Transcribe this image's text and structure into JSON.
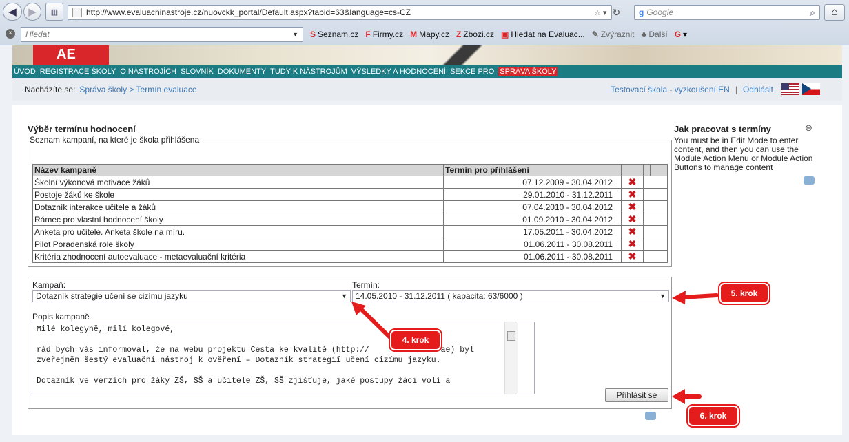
{
  "browser": {
    "url": "http://www.evaluacninastroje.cz/nuovckk_portal/Default.aspx?tabid=63&language=cs-CZ",
    "google_placeholder": "Google",
    "search_placeholder": "Hledat",
    "toolbar_items": [
      "Seznam.cz",
      "Firmy.cz",
      "Mapy.cz",
      "Zbozi.cz",
      "Hledat na Evaluac...",
      "Zvýraznit",
      "Další"
    ]
  },
  "banner": {
    "text": "AE"
  },
  "menu": [
    "ÚVOD",
    "REGISTRACE ŠKOLY",
    "O NÁSTROJÍCH",
    "SLOVNÍK",
    "DOKUMENTY",
    "TUDY K NÁSTROJŮM",
    "VÝSLEDKY A HODNOCENÍ",
    "SEKCE PRO",
    "SPRÁVA ŠKOLY"
  ],
  "breadcrumb": {
    "label": "Nacházíte se:",
    "path": "Správa školy > Termín evaluace",
    "school": "Testovací škola - vyzkoušení EN",
    "sep": "|",
    "logout": "Odhlásit"
  },
  "main": {
    "title": "Výběr termínu hodnocení",
    "legend": "Seznam kampaní, na které je škola přihlášena",
    "col_campaign": "Název kampaně",
    "col_term": "Termín pro přihlášení",
    "rows": [
      {
        "name": "Školní výkonová motivace žáků",
        "term": "07.12.2009 - 30.04.2012"
      },
      {
        "name": "Postoje žáků ke škole",
        "term": "29.01.2010 - 31.12.2011"
      },
      {
        "name": "Dotazník interakce učitele a žáků",
        "term": "07.04.2010 - 30.04.2012"
      },
      {
        "name": "Rámec pro vlastní hodnocení školy",
        "term": "01.09.2010 - 30.04.2012"
      },
      {
        "name": "Anketa pro učitele. Anketa škole na míru.",
        "term": "17.05.2011 - 30.04.2012"
      },
      {
        "name": "Pilot Poradenská role školy",
        "term": "01.06.2011 - 30.08.2011"
      },
      {
        "name": "Kritéria zhodnocení autoevaluace - metaevaluační kritéria",
        "term": "01.06.2011 - 30.08.2011"
      }
    ],
    "label_campaign": "Kampaň:",
    "label_term": "Termín:",
    "campaign_value": "Dotazník strategie učení se cizímu jazyku",
    "term_value": "14.05.2010 - 31.12.2011 ( kapacita: 63/6000 )",
    "desc_label": "Popis kampaně",
    "desc_text": "Milé kolegyně, milí kolegové,\n\nrád bych vás informoval, že na webu projektu Cesta ke kvalitě (http://               ae) byl\nzveřejněn šestý evaluační nástroj k ověření – Dotazník strategií učení cizímu jazyku.\n\nDotazník ve verzích pro žáky ZŠ, SŠ a učitele ZŠ, SŠ zjišťuje, jaké postupy žáci volí a",
    "button": "Přihlásit se"
  },
  "side": {
    "title": "Jak pracovat s termíny",
    "text": "You must be in Edit Mode to enter content, and then you can use the Module Action Menu or Module Action Buttons to manage content"
  },
  "callouts": {
    "step4": "4. krok",
    "step5": "5. krok",
    "step6": "6. krok"
  },
  "colors": {
    "menu": "#1b7c84",
    "accent": "#d9262b",
    "link": "#3a78b8",
    "callout": "#e41c1c"
  }
}
